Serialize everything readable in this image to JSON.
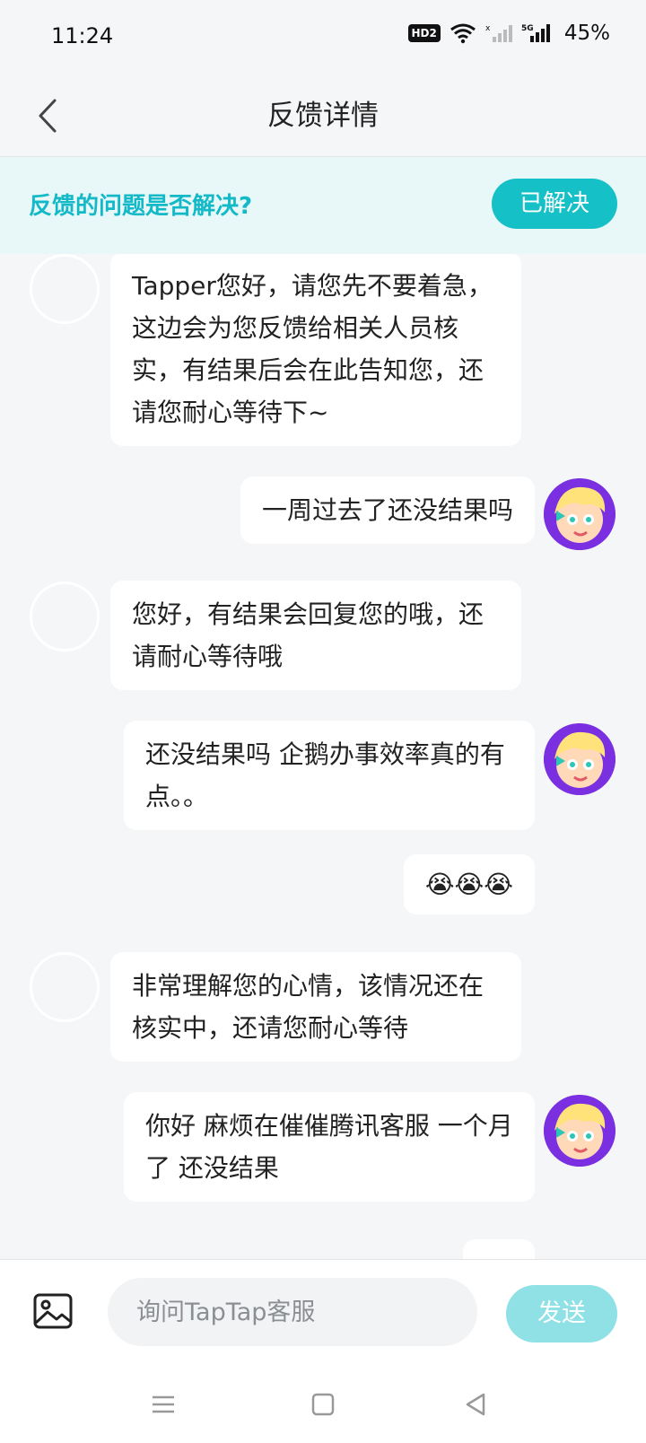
{
  "status_bar": {
    "time": "11:24",
    "hd_badge": "HD2",
    "battery": "45%",
    "icons": [
      "hd-voice-icon",
      "wifi-icon",
      "signal-no-sim-icon",
      "signal-5g-icon"
    ]
  },
  "header": {
    "title": "反馈详情",
    "back_icon": "chevron-left-icon"
  },
  "resolve_banner": {
    "question": "反馈的问题是否解决?",
    "button_label": "已解决"
  },
  "messages": [
    {
      "side": "left",
      "text": "Tapper您好，请您先不要着急，这边会为您反馈给相关人员核实，有结果后会在此告知您，还请您耐心等待下~"
    },
    {
      "side": "right",
      "text": "一周过去了还没结果吗"
    },
    {
      "side": "left",
      "text": "您好，有结果会回复您的哦，还请耐心等待哦"
    },
    {
      "side": "right",
      "text": "还没结果吗 企鹅办事效率真的有点。。"
    },
    {
      "side": "right",
      "text": "😭😭😭"
    },
    {
      "side": "left",
      "text": "非常理解您的心情，该情况还在核实中，还请您耐心等待"
    },
    {
      "side": "right",
      "text": "你好 麻烦在催催腾讯客服 一个月了 还没结果"
    }
  ],
  "input_bar": {
    "image_icon": "image-icon",
    "placeholder": "询问TapTap客服",
    "send_label": "发送"
  },
  "colors": {
    "accent": "#15c0c7",
    "send_disabled": "#8fe1e5",
    "banner_bg": "#e8f7f8",
    "page_bg": "#f5f6f8"
  }
}
